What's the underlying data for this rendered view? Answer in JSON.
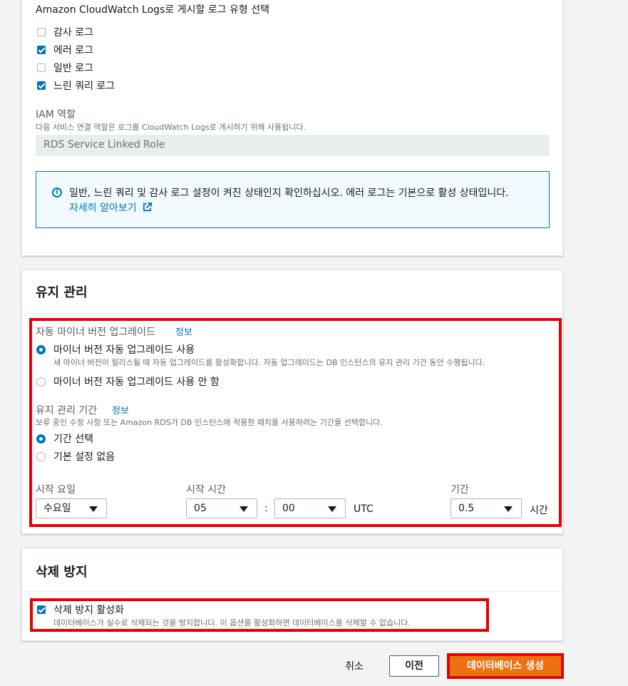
{
  "logs": {
    "heading": "Amazon CloudWatch Logs로 게시할 로그 유형 선택",
    "types": [
      {
        "label": "감사 로그",
        "checked": false
      },
      {
        "label": "에러 로그",
        "checked": true
      },
      {
        "label": "일반 로그",
        "checked": false
      },
      {
        "label": "느린 쿼리 로그",
        "checked": true
      }
    ],
    "iam_label": "IAM 역할",
    "iam_desc": "다음 서비스 연결 역할은 로그를 CloudWatch Logs로 게시하기 위해 사용됩니다.",
    "iam_value": "RDS Service Linked Role",
    "info_text": "일반, 느린 쿼리 및 감사 로그 설정이 켜진 상태인지 확인하십시오. 에러 로그는 기본으로 활성 상태입니다.",
    "info_link": "자세히 알아보기"
  },
  "maintenance": {
    "title": "유지 관리",
    "auto_upgrade_label": "자동 마이너 버전 업그레이드",
    "info": "정보",
    "enable_label": "마이너 버전 자동 업그레이드 사용",
    "enable_desc": "새 마이너 버전이 릴리스될 때 자동 업그레이드를 활성화합니다. 자동 업그레이드는 DB 인스턴스의 유지 관리 기간 동안 수행됩니다.",
    "disable_label": "마이너 버전 자동 업그레이드 사용 안 함",
    "window_label": "유지 관리 기간",
    "window_desc": "보류 중인 수정 사항 또는 Amazon RDS가 DB 인스턴스에 적용한 패치를 사용하려는 기간을 선택합니다.",
    "select_window": "기간 선택",
    "no_pref": "기본 설정 없음",
    "start_day_label": "시작 요일",
    "start_day": "수요일",
    "start_time_label": "시작 시간",
    "hour": "05",
    "colon": ":",
    "minute": "00",
    "tz": "UTC",
    "duration_label": "기간",
    "duration": "0.5",
    "duration_unit": "시간"
  },
  "deletion": {
    "title": "삭제 방지",
    "label": "삭제 방지 활성화",
    "desc": "데이터베이스가 실수로 삭제되는 것을 방지합니다. 이 옵션을 활성화하면 데이터베이스를 삭제할 수 없습니다.",
    "checked": true
  },
  "footer": {
    "cancel": "취소",
    "previous": "이전",
    "create": "데이터베이스 생성"
  },
  "colors": {
    "accent": "#0073bb",
    "primary_button": "#ec7211",
    "highlight": "#e60000"
  }
}
